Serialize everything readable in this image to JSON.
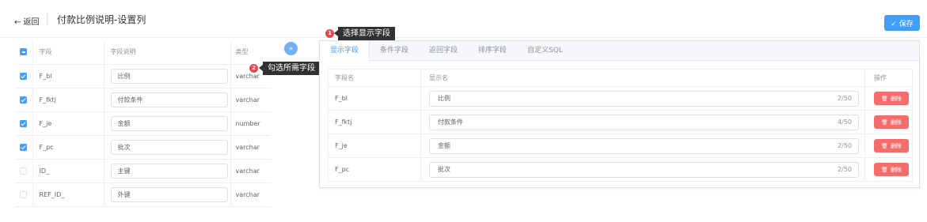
{
  "header": {
    "back_label": "← 返回",
    "title": "付款比例说明-设置列",
    "save_label": "✓ 保存"
  },
  "tips": [
    {
      "num": "1",
      "text": "选择显示字段"
    },
    {
      "num": "2",
      "text": "勾选所需字段"
    }
  ],
  "left": {
    "columns": [
      "字段",
      "字段说明",
      "类型"
    ],
    "rows": [
      {
        "field": "F_bl",
        "desc": "比例",
        "type": "varchar",
        "checked": true
      },
      {
        "field": "F_fktj",
        "desc": "付款条件",
        "type": "varchar",
        "checked": true
      },
      {
        "field": "F_je",
        "desc": "金额",
        "type": "number",
        "checked": true
      },
      {
        "field": "F_pc",
        "desc": "批次",
        "type": "varchar",
        "checked": true
      },
      {
        "field": "ID_",
        "desc": "主键",
        "type": "varchar",
        "checked": false
      },
      {
        "field": "REF_ID_",
        "desc": "外键",
        "type": "varchar",
        "checked": false
      }
    ]
  },
  "transfer_icon": "»",
  "right": {
    "tabs": [
      "显示字段",
      "条件字段",
      "返回字段",
      "排序字段",
      "自定义SQL"
    ],
    "columns": [
      "字段名",
      "显示名",
      "操作"
    ],
    "rows": [
      {
        "field": "F_bl",
        "display": "比例",
        "count": "2/50"
      },
      {
        "field": "F_fktj",
        "display": "付款条件",
        "count": "4/50"
      },
      {
        "field": "F_je",
        "display": "金额",
        "count": "2/50"
      },
      {
        "field": "F_pc",
        "display": "批次",
        "count": "2/50"
      }
    ],
    "delete_label": "删除",
    "delete_icon": "🗑"
  },
  "colors": {
    "primary": "#409eff",
    "danger": "#f56c6c",
    "tip_bg": "#303133",
    "tip_badge": "#e8454f"
  }
}
